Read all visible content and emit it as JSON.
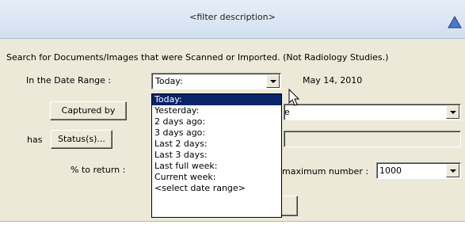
{
  "header": {
    "title": "<filter description>"
  },
  "filter": {
    "description": "Search for Documents/Images that were Scanned or Imported.  (Not Radiology Studies.)",
    "date_range_label": "In the Date Range :",
    "date_range_value": "Today:",
    "date_display": "May 14, 2010",
    "captured_by_label": "Captured by",
    "has_label": "has",
    "status_label": "Status(s)...",
    "percent_label": "% to return :",
    "max_number_label": "maximum number :",
    "max_number_value": "1000",
    "captured_field_partial": "e"
  },
  "date_options": [
    "Today:",
    "Yesterday:",
    "2 days ago:",
    "3 days ago:",
    "Last 2 days:",
    "Last 3 days:",
    "Last full week:",
    "Current week:",
    "<select date range>"
  ],
  "selected_option_index": 0,
  "colors": {
    "selection": "#0a246a",
    "panel": "#ece9d8",
    "header": "#d2dff0"
  }
}
